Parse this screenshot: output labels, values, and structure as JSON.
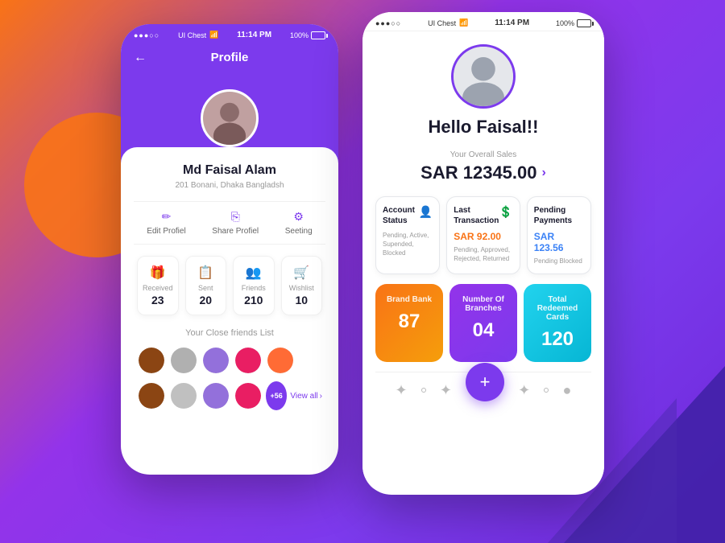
{
  "background": {
    "gradient_start": "#f97316",
    "gradient_end": "#6d28d9"
  },
  "left_phone": {
    "status_bar": {
      "dots": "●●●○○",
      "carrier": "UI Chest",
      "wifi_icon": "wifi",
      "time": "11:14 PM",
      "battery": "100%"
    },
    "header": {
      "back_label": "←",
      "title": "Profile"
    },
    "profile": {
      "name": "Md Faisal Alam",
      "address": "201 Bonani, Dhaka Bangladsh"
    },
    "actions": [
      {
        "icon": "✏️",
        "label": "Edit Profiel"
      },
      {
        "icon": "⎘",
        "label": "Share Profiel"
      },
      {
        "icon": "⚙",
        "label": "Seeting"
      }
    ],
    "stats": [
      {
        "icon": "🎁",
        "label": "Received",
        "value": "23",
        "color": "purple"
      },
      {
        "icon": "📋",
        "label": "Sent",
        "value": "20",
        "color": "orange"
      },
      {
        "icon": "👥",
        "label": "Friends",
        "value": "210",
        "color": "blue"
      },
      {
        "icon": "🛒",
        "label": "Wishlist",
        "value": "10",
        "color": "teal"
      }
    ],
    "friends": {
      "title": "Your Close friends List",
      "row1": [
        "#8B4513",
        "#D2691E",
        "#9370DB",
        "#E91E63",
        "#FF6B35"
      ],
      "row2": [
        "#8B4513",
        "#C0C0C0",
        "#9370DB",
        "#E91E63"
      ],
      "more_count": "+56",
      "view_all": "View all"
    }
  },
  "right_phone": {
    "status_bar": {
      "dots": "●●●○○",
      "carrier": "UI Chest",
      "wifi_icon": "wifi",
      "time": "11:14 PM",
      "battery": "100%"
    },
    "greeting": "Hello Faisal!!",
    "sales": {
      "label": "Your Overall Sales",
      "amount": "SAR 12345.00",
      "arrow": "›"
    },
    "info_cards": [
      {
        "title": "Account Status",
        "icon": "👤",
        "value": "",
        "sub": "Pending, Active, Supended, Blocked"
      },
      {
        "title": "Last Transaction",
        "icon": "💲",
        "value": "SAR 92.00",
        "sub": "Pending, Approved, Rejected, Returned"
      },
      {
        "title": "Pending Payments",
        "icon": "",
        "value": "SAR 123.56",
        "sub": "Pending Blocked"
      }
    ],
    "bottom_cards": [
      {
        "label": "Brand Bank",
        "value": "87",
        "color": "orange"
      },
      {
        "label": "Number Of Branches",
        "value": "04",
        "color": "purple"
      },
      {
        "label": "Total Redeemed Cards",
        "value": "120",
        "color": "teal"
      }
    ],
    "bottom_nav": {
      "icons": [
        "✦",
        "○",
        "✦",
        "+",
        "✦",
        "○",
        "●"
      ]
    }
  }
}
